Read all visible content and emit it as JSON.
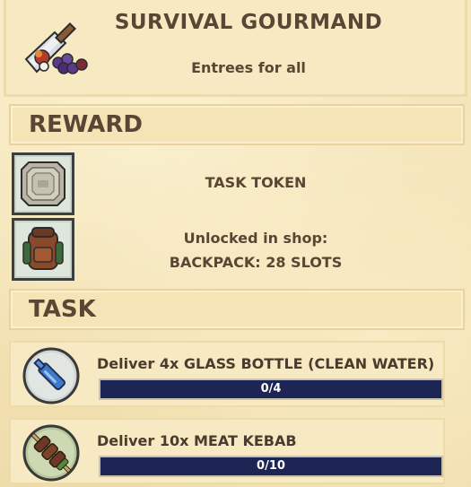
{
  "header": {
    "title": "SURVIVAL GOURMAND",
    "subtitle": "Entrees for all",
    "icon": "cleaver-with-fruit-icon"
  },
  "reward": {
    "heading": "REWARD",
    "items": [
      {
        "icon": "task-token-icon",
        "text": "TASK TOKEN"
      },
      {
        "icon": "backpack-icon",
        "line1": "Unlocked in shop:",
        "line2": "BACKPACK: 28 SLOTS"
      }
    ]
  },
  "task": {
    "heading": "TASK",
    "items": [
      {
        "icon": "glass-bottle-icon",
        "label": "Deliver 4x GLASS BOTTLE (CLEAN WATER)",
        "progress_text": "0/4",
        "progress": 0
      },
      {
        "icon": "meat-kebab-icon",
        "label": "Deliver 10x MEAT KEBAB",
        "progress_text": "0/10",
        "progress": 0
      }
    ]
  },
  "colors": {
    "parchment": "#f2e2b6",
    "text": "#5a4634",
    "progress_bg": "#1d2554"
  }
}
